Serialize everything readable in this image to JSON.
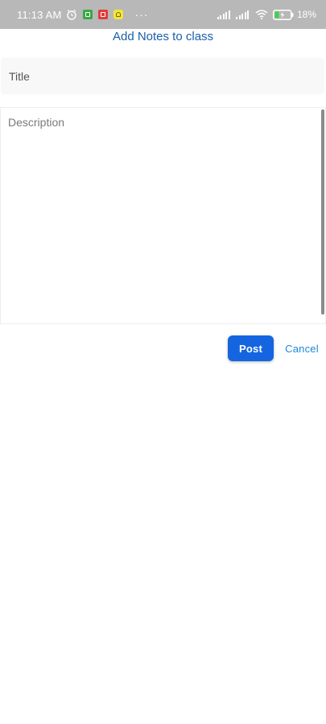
{
  "status_bar": {
    "time": "11:13 AM",
    "more": "···",
    "battery": "18%"
  },
  "header": {
    "title": "Add Notes to class"
  },
  "form": {
    "title_placeholder": "Title",
    "title_value": "",
    "description_placeholder": "Description",
    "description_value": ""
  },
  "actions": {
    "post_label": "Post",
    "cancel_label": "Cancel"
  },
  "icons": {
    "alarm": "alarm-icon",
    "wifi": "wifi-icon",
    "battery": "battery-charging-icon"
  },
  "colors": {
    "title": "#1b5fa8",
    "primary_button": "#1565e0",
    "link": "#1a8ad6",
    "status_bar": "#b8b8b8"
  }
}
